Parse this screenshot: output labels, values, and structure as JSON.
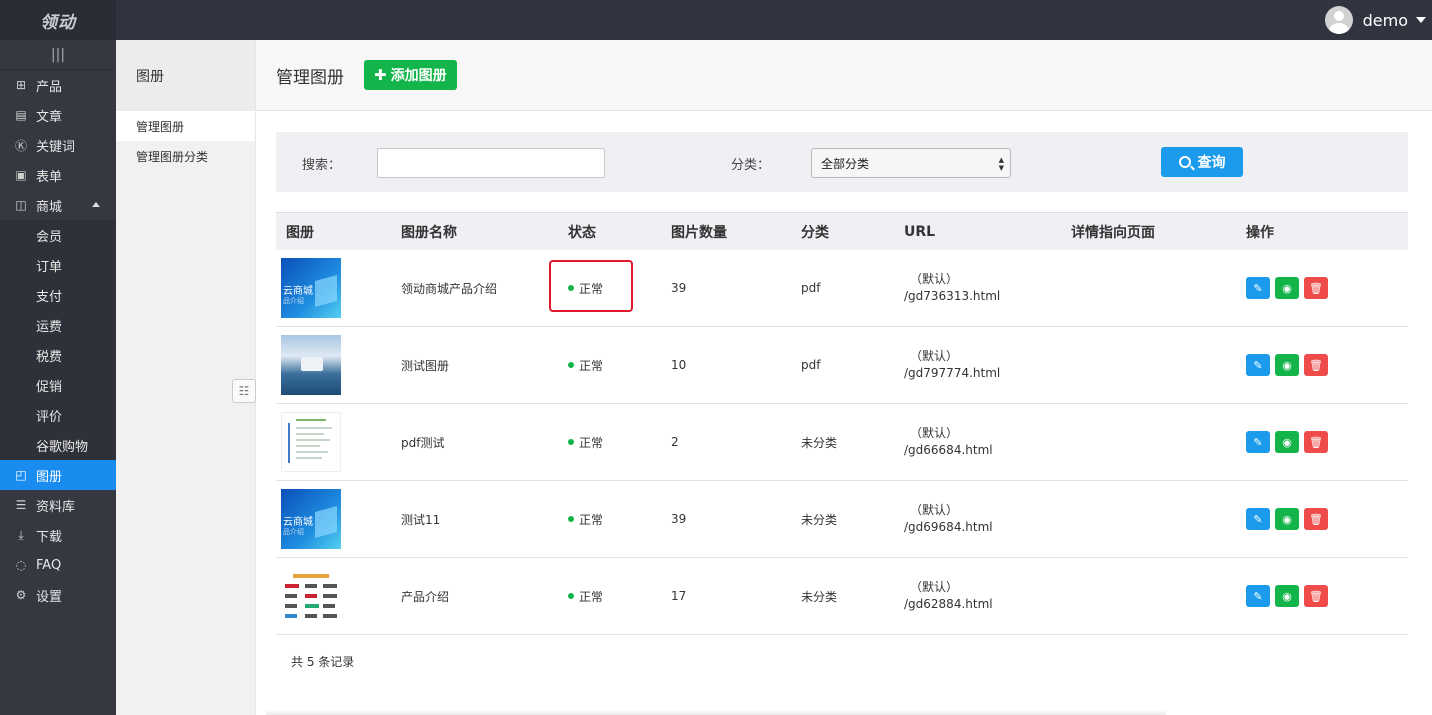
{
  "header": {
    "logo": "领动",
    "username": "demo"
  },
  "sidebar": {
    "items": [
      {
        "label": "产品",
        "icon": "grid-icon"
      },
      {
        "label": "文章",
        "icon": "document-icon"
      },
      {
        "label": "关键词",
        "icon": "keyword-icon"
      },
      {
        "label": "表单",
        "icon": "clipboard-icon"
      },
      {
        "label": "商城",
        "icon": "shop-bag-icon",
        "expanded": true
      },
      {
        "label": "会员",
        "sub": true
      },
      {
        "label": "订单",
        "sub": true
      },
      {
        "label": "支付",
        "sub": true
      },
      {
        "label": "运费",
        "sub": true
      },
      {
        "label": "税费",
        "sub": true
      },
      {
        "label": "促销",
        "sub": true
      },
      {
        "label": "评价",
        "sub": true
      },
      {
        "label": "谷歌购物",
        "sub": true
      },
      {
        "label": "图册",
        "icon": "album-icon",
        "active": true
      },
      {
        "label": "资料库",
        "icon": "database-icon"
      },
      {
        "label": "下载",
        "icon": "download-icon"
      },
      {
        "label": "FAQ",
        "icon": "chat-icon"
      },
      {
        "label": "设置",
        "icon": "gear-icon"
      }
    ]
  },
  "subnav": {
    "title": "图册",
    "items": [
      {
        "label": "管理图册"
      },
      {
        "label": "管理图册分类"
      }
    ]
  },
  "main": {
    "title": "管理图册",
    "add_button": "添加图册",
    "search_label": "搜索：",
    "search_value": "",
    "category_label": "分类：",
    "category_selected": "全部分类",
    "query_button": "查询"
  },
  "table": {
    "headers": [
      "图册",
      "图册名称",
      "状态",
      "图片数量",
      "分类",
      "URL",
      "详情指向页面",
      "操作"
    ],
    "rows": [
      {
        "name": "领动商城产品介绍",
        "status": "正常",
        "count": "39",
        "category": "pdf",
        "url_default": "（默认）",
        "url": "/gd736313.html",
        "thumb_text": "云商城",
        "thumb_sub": "品介绍"
      },
      {
        "name": "测试图册",
        "status": "正常",
        "count": "10",
        "category": "pdf",
        "url_default": "（默认）",
        "url": "/gd797774.html"
      },
      {
        "name": "pdf测试",
        "status": "正常",
        "count": "2",
        "category": "未分类",
        "url_default": "（默认）",
        "url": "/gd66684.html"
      },
      {
        "name": "测试11",
        "status": "正常",
        "count": "39",
        "category": "未分类",
        "url_default": "（默认）",
        "url": "/gd69684.html",
        "thumb_text": "云商城",
        "thumb_sub": "品介绍"
      },
      {
        "name": "产品介绍",
        "status": "正常",
        "count": "17",
        "category": "未分类",
        "url_default": "（默认）",
        "url": "/gd62884.html"
      }
    ]
  },
  "footer": {
    "total": "共 5 条记录"
  },
  "colors": {
    "primary": "#1c9bec",
    "success": "#13b54a",
    "danger": "#ef4b4b",
    "sidebar": "#353741",
    "highlight": "#e0182d"
  }
}
